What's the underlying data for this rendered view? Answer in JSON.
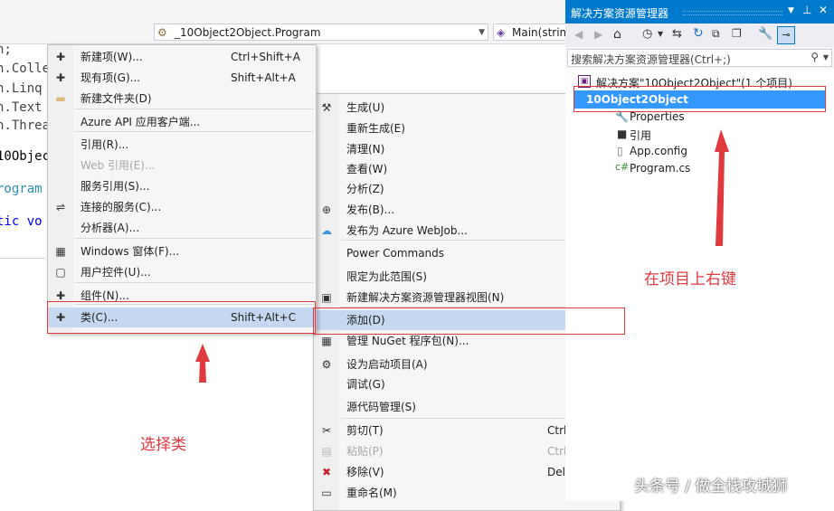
{
  "editor": {
    "combo_type": "_10Object2Object.Program",
    "combo_member": "Main(strin",
    "code_lines": [
      "n;",
      "n.Colle",
      "n.Linq",
      "n.Text",
      "n.Threa",
      "10Objec",
      "rogram",
      "tic vo"
    ]
  },
  "add_submenu": {
    "items": [
      {
        "label": "新建项(W)...",
        "shortcut": "Ctrl+Shift+A",
        "icon": "new-item-icon"
      },
      {
        "label": "现有项(G)...",
        "shortcut": "Shift+Alt+A",
        "icon": "existing-item-icon"
      },
      {
        "label": "新建文件夹(D)",
        "shortcut": "",
        "icon": "folder-icon"
      },
      {
        "label": "Azure API 应用客户端...",
        "shortcut": "",
        "icon": ""
      },
      {
        "label": "引用(R)...",
        "shortcut": "",
        "icon": ""
      },
      {
        "label": "Web 引用(E)...",
        "shortcut": "",
        "icon": ""
      },
      {
        "label": "服务引用(S)...",
        "shortcut": "",
        "icon": ""
      },
      {
        "label": "连接的服务(C)...",
        "shortcut": "",
        "icon": "connected-service-icon"
      },
      {
        "label": "分析器(A)...",
        "shortcut": "",
        "icon": ""
      },
      {
        "label": "Windows 窗体(F)...",
        "shortcut": "",
        "icon": "windows-form-icon"
      },
      {
        "label": "用户控件(U)...",
        "shortcut": "",
        "icon": "user-control-icon"
      },
      {
        "label": "组件(N)...",
        "shortcut": "",
        "icon": "component-icon"
      },
      {
        "label": "类(C)...",
        "shortcut": "Shift+Alt+C",
        "icon": "class-icon"
      }
    ]
  },
  "project_menu": {
    "items": [
      {
        "label": "生成(U)",
        "shortcut": "",
        "icon": "build-icon"
      },
      {
        "label": "重新生成(E)",
        "shortcut": "",
        "icon": ""
      },
      {
        "label": "清理(N)",
        "shortcut": "",
        "icon": ""
      },
      {
        "label": "查看(W)",
        "shortcut": "",
        "icon": ""
      },
      {
        "label": "分析(Z)",
        "shortcut": "",
        "icon": ""
      },
      {
        "label": "发布(B)...",
        "shortcut": "",
        "icon": "publish-globe-icon"
      },
      {
        "label": "发布为 Azure WebJob...",
        "shortcut": "",
        "icon": "azure-cloud-icon"
      },
      {
        "label": "Power Commands",
        "shortcut": "",
        "icon": ""
      },
      {
        "label": "限定为此范围(S)",
        "shortcut": "",
        "icon": ""
      },
      {
        "label": "新建解决方案资源管理器视图(N)",
        "shortcut": "",
        "icon": "new-view-icon"
      },
      {
        "label": "添加(D)",
        "shortcut": "",
        "icon": ""
      },
      {
        "label": "管理 NuGet 程序包(N)...",
        "shortcut": "",
        "icon": "nuget-icon"
      },
      {
        "label": "设为启动项目(A)",
        "shortcut": "",
        "icon": "gear-icon"
      },
      {
        "label": "调试(G)",
        "shortcut": "",
        "icon": ""
      },
      {
        "label": "源代码管理(S)",
        "shortcut": "",
        "icon": ""
      },
      {
        "label": "剪切(T)",
        "shortcut": "Ctrl+X",
        "icon": "scissors-icon"
      },
      {
        "label": "粘贴(P)",
        "shortcut": "Ctrl+V",
        "icon": "paste-icon"
      },
      {
        "label": "移除(V)",
        "shortcut": "Del",
        "icon": "remove-x-icon"
      },
      {
        "label": "重命名(M)",
        "shortcut": "",
        "icon": "rename-icon"
      }
    ]
  },
  "solution_explorer": {
    "title": "解决方案资源管理器",
    "search_placeholder": "搜索解决方案资源管理器(Ctrl+;)",
    "solution": "解决方案\"10Object2Object\"(1 个项目)",
    "project": "10Object2Object",
    "children": [
      "Properties",
      "引用",
      "App.config",
      "Program.cs"
    ]
  },
  "annotations": {
    "right_click_note": "在项目上右键",
    "select_class_note": "选择类",
    "watermark": "头条号 / 做全栈攻城狮"
  },
  "colors": {
    "accent": "#007acc",
    "annotation_red": "#e0393e",
    "highlight": "#c5d8f0"
  }
}
